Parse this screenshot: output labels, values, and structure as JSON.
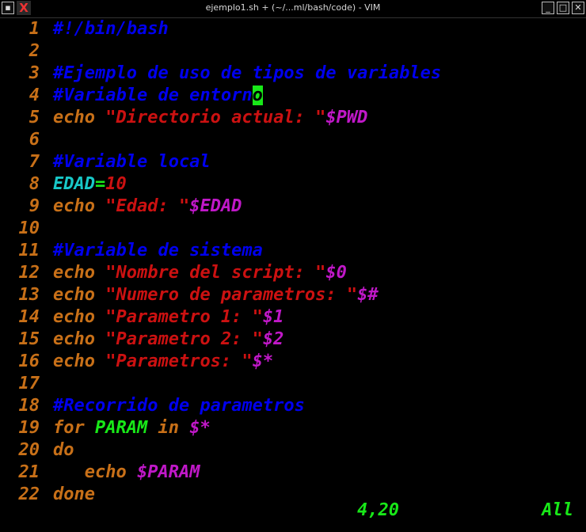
{
  "window": {
    "title": "ejemplo1.sh + (~/...ml/bash/code) - VIM",
    "icons": [
      "menu-icon",
      "vim-app-icon",
      "minimize-icon",
      "maximize-icon",
      "close-icon"
    ]
  },
  "editor": {
    "lines": [
      {
        "n": "1",
        "segs": [
          {
            "t": "#!/bin/bash",
            "c": "comment"
          }
        ]
      },
      {
        "n": "2",
        "segs": []
      },
      {
        "n": "3",
        "segs": [
          {
            "t": "#Ejemplo de uso de tipos de variables",
            "c": "comment"
          }
        ]
      },
      {
        "n": "4",
        "segs": [
          {
            "t": "#Variable de entorn",
            "c": "comment"
          },
          {
            "t": "o",
            "c": "cursor"
          }
        ]
      },
      {
        "n": "5",
        "segs": [
          {
            "t": "echo ",
            "c": "kw"
          },
          {
            "t": "\"Directorio actual: \"",
            "c": "str"
          },
          {
            "t": "$PWD",
            "c": "var"
          }
        ]
      },
      {
        "n": "6",
        "segs": []
      },
      {
        "n": "7",
        "segs": [
          {
            "t": "#Variable local",
            "c": "comment"
          }
        ]
      },
      {
        "n": "8",
        "segs": [
          {
            "t": "EDAD",
            "c": "ident"
          },
          {
            "t": "=",
            "c": "op"
          },
          {
            "t": "10",
            "c": "num"
          }
        ]
      },
      {
        "n": "9",
        "segs": [
          {
            "t": "echo ",
            "c": "kw"
          },
          {
            "t": "\"Edad: \"",
            "c": "str"
          },
          {
            "t": "$EDAD",
            "c": "var"
          }
        ]
      },
      {
        "n": "10",
        "segs": []
      },
      {
        "n": "11",
        "segs": [
          {
            "t": "#Variable de sistema",
            "c": "comment"
          }
        ]
      },
      {
        "n": "12",
        "segs": [
          {
            "t": "echo ",
            "c": "kw"
          },
          {
            "t": "\"Nombre del script: \"",
            "c": "str"
          },
          {
            "t": "$0",
            "c": "var"
          }
        ]
      },
      {
        "n": "13",
        "segs": [
          {
            "t": "echo ",
            "c": "kw"
          },
          {
            "t": "\"Numero de parametros: \"",
            "c": "str"
          },
          {
            "t": "$#",
            "c": "var"
          }
        ]
      },
      {
        "n": "14",
        "segs": [
          {
            "t": "echo ",
            "c": "kw"
          },
          {
            "t": "\"Parametro 1: \"",
            "c": "str"
          },
          {
            "t": "$1",
            "c": "var"
          }
        ]
      },
      {
        "n": "15",
        "segs": [
          {
            "t": "echo ",
            "c": "kw"
          },
          {
            "t": "\"Parametro 2: \"",
            "c": "str"
          },
          {
            "t": "$2",
            "c": "var"
          }
        ]
      },
      {
        "n": "16",
        "segs": [
          {
            "t": "echo ",
            "c": "kw"
          },
          {
            "t": "\"Parametros: \"",
            "c": "str"
          },
          {
            "t": "$*",
            "c": "var"
          }
        ]
      },
      {
        "n": "17",
        "segs": []
      },
      {
        "n": "18",
        "segs": [
          {
            "t": "#Recorrido de parametros",
            "c": "comment"
          }
        ]
      },
      {
        "n": "19",
        "segs": [
          {
            "t": "for ",
            "c": "kw"
          },
          {
            "t": "PARAM",
            "c": "param"
          },
          {
            "t": " in ",
            "c": "kw"
          },
          {
            "t": "$*",
            "c": "var"
          }
        ]
      },
      {
        "n": "20",
        "segs": [
          {
            "t": "do",
            "c": "kw"
          }
        ]
      },
      {
        "n": "21",
        "segs": [
          {
            "t": "   echo ",
            "c": "kw"
          },
          {
            "t": "$PARAM",
            "c": "var"
          }
        ]
      },
      {
        "n": "22",
        "segs": [
          {
            "t": "done",
            "c": "kw"
          }
        ]
      }
    ]
  },
  "statusline": {
    "position": "4,20",
    "percent": "All"
  },
  "colors": {
    "comment": "#0000ee",
    "keyword": "#c87018",
    "string": "#cc1111",
    "variable": "#c018c8",
    "cursor": "#18e818"
  }
}
